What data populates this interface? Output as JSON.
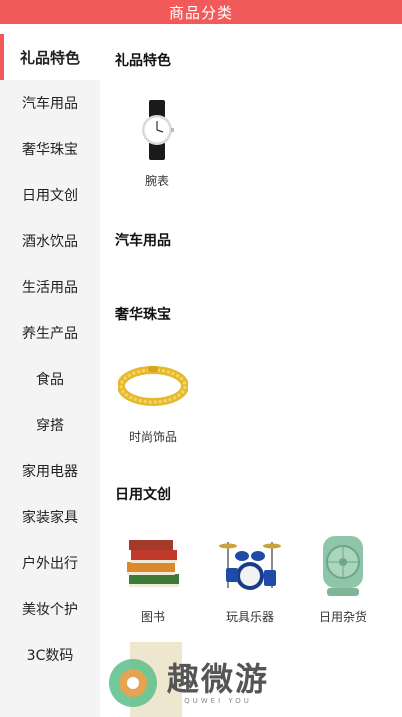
{
  "header": {
    "title": "商品分类"
  },
  "sidebar": {
    "items": [
      {
        "label": "礼品特色",
        "active": true
      },
      {
        "label": "汽车用品"
      },
      {
        "label": "奢华珠宝"
      },
      {
        "label": "日用文创"
      },
      {
        "label": "酒水饮品"
      },
      {
        "label": "生活用品"
      },
      {
        "label": "养生产品"
      },
      {
        "label": "食品"
      },
      {
        "label": "穿搭"
      },
      {
        "label": "家用电器"
      },
      {
        "label": "家装家具"
      },
      {
        "label": "户外出行"
      },
      {
        "label": "美妆个护"
      },
      {
        "label": "3C数码"
      }
    ]
  },
  "main": {
    "sections": [
      {
        "title": "礼品特色",
        "products": [
          {
            "name": "腕表",
            "icon": "watch-icon"
          }
        ]
      },
      {
        "title": "汽车用品",
        "products": []
      },
      {
        "title": "奢华珠宝",
        "products": [
          {
            "name": "时尚饰品",
            "icon": "bracelet-icon"
          }
        ]
      },
      {
        "title": "日用文创",
        "products": [
          {
            "name": "图书",
            "icon": "books-icon"
          },
          {
            "name": "玩具乐器",
            "icon": "drum-kit-icon"
          },
          {
            "name": "日用杂货",
            "icon": "fan-icon"
          }
        ]
      }
    ]
  },
  "watermark": {
    "brand": "趣微游",
    "sub": "QUWEI YOU"
  },
  "colors": {
    "accent": "#f25a5a",
    "sidebar_bg": "#f4f4f4"
  }
}
